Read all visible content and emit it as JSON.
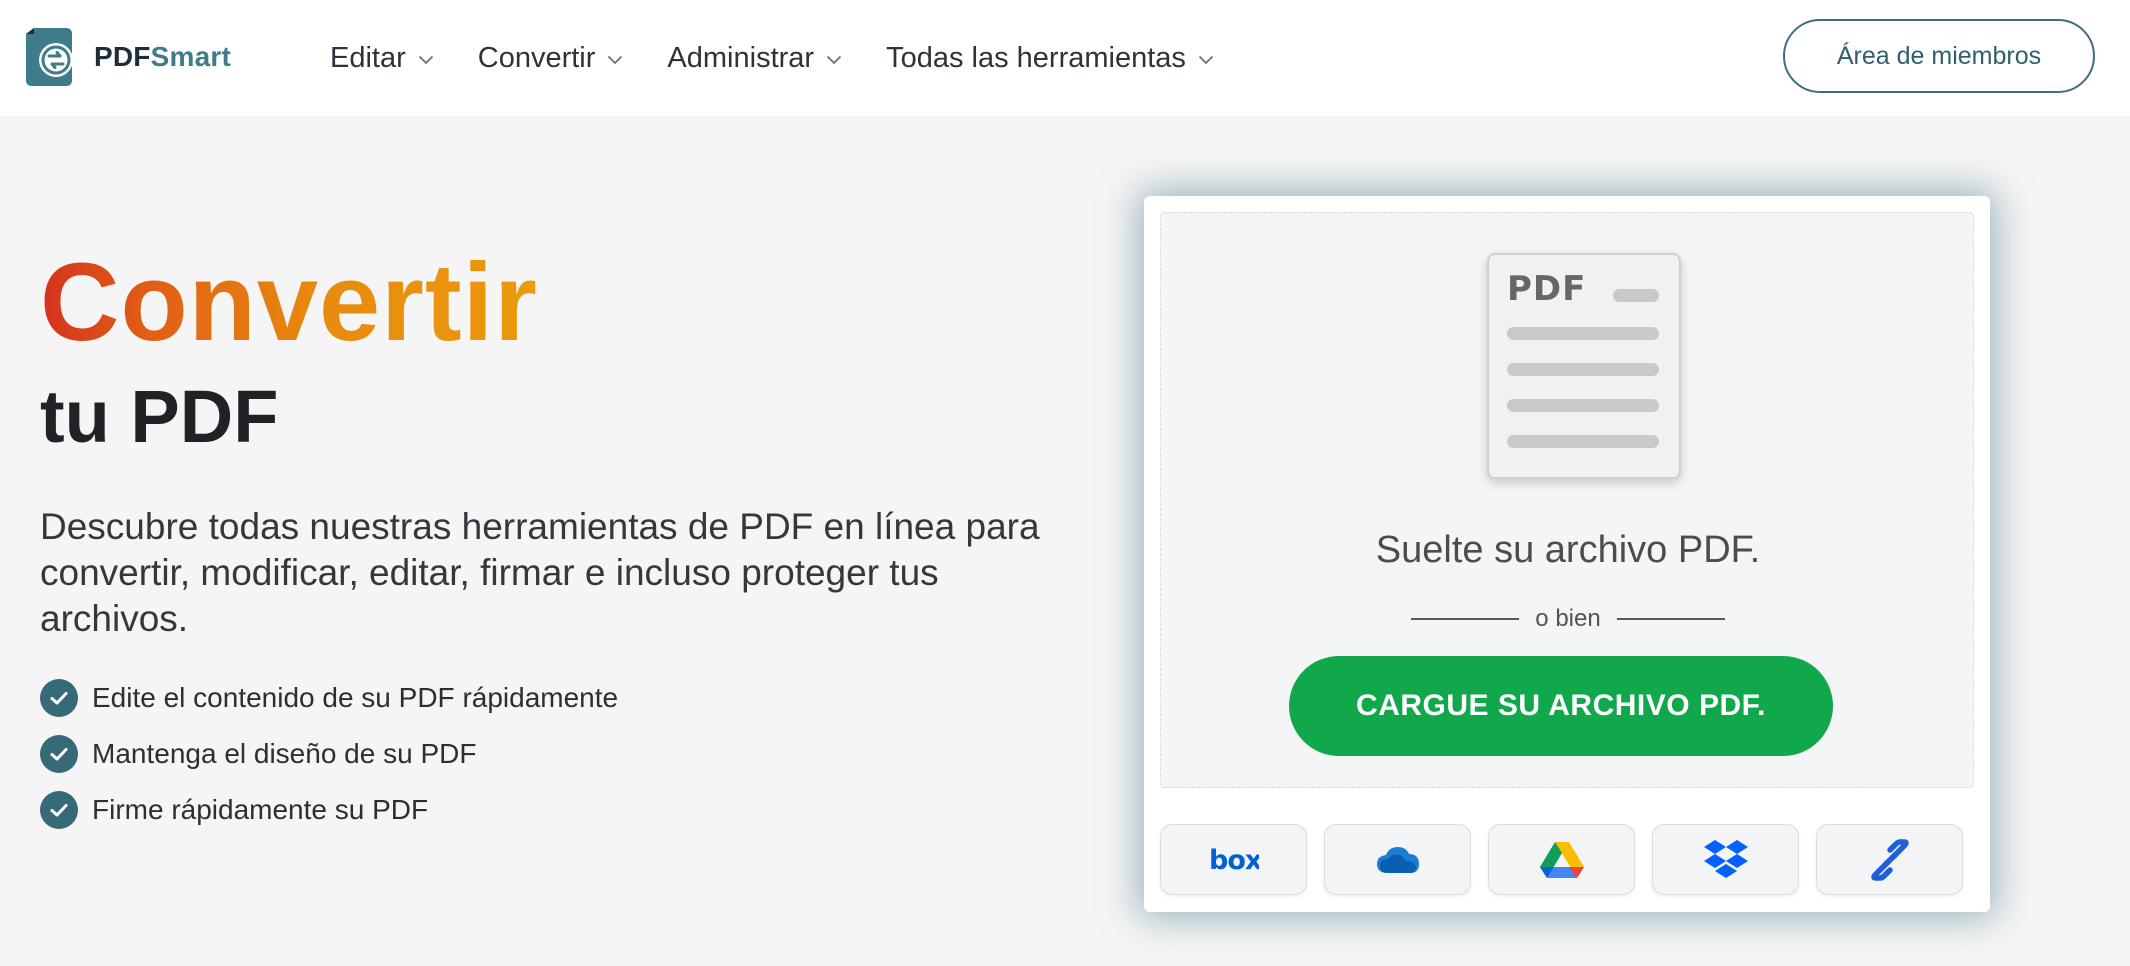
{
  "header": {
    "logo": {
      "brand_part1": "PDF",
      "brand_part2": "Smart"
    },
    "nav": [
      {
        "label": "Editar"
      },
      {
        "label": "Convertir"
      },
      {
        "label": "Administrar"
      },
      {
        "label": "Todas las herramientas"
      }
    ],
    "members_button": "Área de miembros"
  },
  "hero": {
    "title": "Convertir",
    "subtitle": "tu PDF",
    "description": "Descubre todas nuestras herramientas de PDF en línea para convertir, modificar, editar, firmar e incluso proteger tus archivos.",
    "features": [
      "Edite el contenido de su PDF rápidamente",
      "Mantenga el diseño de su PDF",
      "Firme rápidamente su PDF"
    ]
  },
  "upload": {
    "doc_icon_label": "PDF",
    "drop_text": "Suelte su archivo PDF.",
    "divider_text": "o bien",
    "button_label": "CARGUE SU ARCHIVO PDF.",
    "services": [
      {
        "name": "box",
        "icon": "box-icon"
      },
      {
        "name": "onedrive",
        "icon": "onedrive-icon"
      },
      {
        "name": "google-drive",
        "icon": "google-drive-icon"
      },
      {
        "name": "dropbox",
        "icon": "dropbox-icon"
      },
      {
        "name": "link",
        "icon": "link-icon"
      }
    ]
  },
  "colors": {
    "accent_teal": "#356a76",
    "title_gradient_start": "#d4321e",
    "title_gradient_end": "#eb9b0c",
    "upload_green": "#10a84b"
  }
}
